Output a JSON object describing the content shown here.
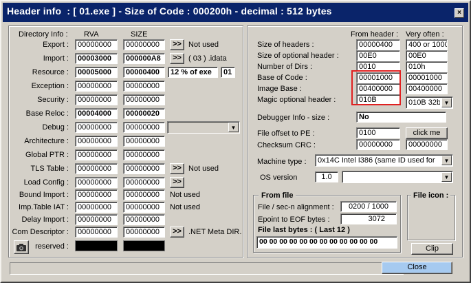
{
  "window": {
    "title": "Header info  : [ 01.exe ] - Size of Code : 000200h - decimal : 512 bytes",
    "close_glyph": "×"
  },
  "left": {
    "hdr_dir": "Directory Info :",
    "hdr_rva": "RVA",
    "hdr_size": "SIZE",
    "rows": [
      {
        "label": "Export :",
        "rva": "00000000",
        "size": "00000000",
        "btn": ">>",
        "note": "Not used"
      },
      {
        "label": "Import :",
        "rva": "00003000",
        "size": "000000A8",
        "btn": ">>",
        "note": "( 03 ) .idata"
      },
      {
        "label": "Resource :",
        "rva": "00005000",
        "size": "00000400",
        "pct": "12  % of exe",
        "num": "01"
      },
      {
        "label": "Exception :",
        "rva": "00000000",
        "size": "00000000"
      },
      {
        "label": "Security :",
        "rva": "00000000",
        "size": "00000000"
      },
      {
        "label": "Base Reloc :",
        "rva": "00004000",
        "size": "00000020"
      },
      {
        "label": "Debug :",
        "rva": "00000000",
        "size": "00000000"
      },
      {
        "label": "Architecture :",
        "rva": "00000000",
        "size": "00000000"
      },
      {
        "label": "Global PTR :",
        "rva": "00000000",
        "size": "00000000"
      },
      {
        "label": "TLS Table :",
        "rva": "00000000",
        "size": "00000000",
        "btn": ">>",
        "note": "Not used"
      },
      {
        "label": "Load Config :",
        "rva": "00000000",
        "size": "00000000",
        "btn": ">>"
      },
      {
        "label": "Bound Import :",
        "rva": "00000000",
        "size": "00000000",
        "note": "Not used"
      },
      {
        "label": "Imp.Table IAT :",
        "rva": "00000000",
        "size": "00000000",
        "note": "Not used"
      },
      {
        "label": "Delay Import :",
        "rva": "00000000",
        "size": "00000000"
      },
      {
        "label": "Com Descriptor :",
        "rva": "00000000",
        "size": "00000000",
        "btn": ">>",
        "note": ".NET Meta DIR."
      }
    ],
    "reserved_label": "reserved :",
    "camera_icon": "camera-icon"
  },
  "right": {
    "hdr_from": "From header :",
    "hdr_often": "Very often :",
    "rows": [
      {
        "label": "Size of headers :",
        "from": "00000400",
        "often": "400 or 1000"
      },
      {
        "label": "Size of optional header :",
        "from": "00E0",
        "often": "00E0"
      },
      {
        "label": "Number of Dirs :",
        "from": "0010",
        "often": "010h"
      },
      {
        "label": "Base of Code :",
        "from": "00001000",
        "often": "00001000"
      },
      {
        "label": "Image Base :",
        "from": "00400000",
        "often": "00400000"
      },
      {
        "label": "Magic optional header :",
        "from": "010B",
        "often": "010B 32bit"
      }
    ],
    "debugger_label": "Debugger Info  -  size :",
    "debugger_value": "No",
    "offset_label": "File offset to PE :",
    "offset_value": "0100",
    "clickme": "click me",
    "crc_label": "Checksum CRC :",
    "crc_value": "00000000",
    "crc_often": "00000000",
    "machine_label": "Machine type :",
    "machine_value": "0x14C    Intel I386 (same ID used for",
    "os_label": "OS version",
    "os_value": "1.0",
    "os_combo": "",
    "fromfile_title": "From file",
    "align_label": "File / sec-n alignment :",
    "align_value": "0200  /  1000",
    "eof_label": "Epoint to EOF bytes :",
    "eof_value": "3072",
    "lastbytes_label": "File last bytes : ( Last 12 )",
    "lastbytes_value": "00 00 00 00 00 00 00 00 00 00 00 00",
    "fileicon_title": "File icon :",
    "clip": "Clip",
    "close": "Close"
  }
}
